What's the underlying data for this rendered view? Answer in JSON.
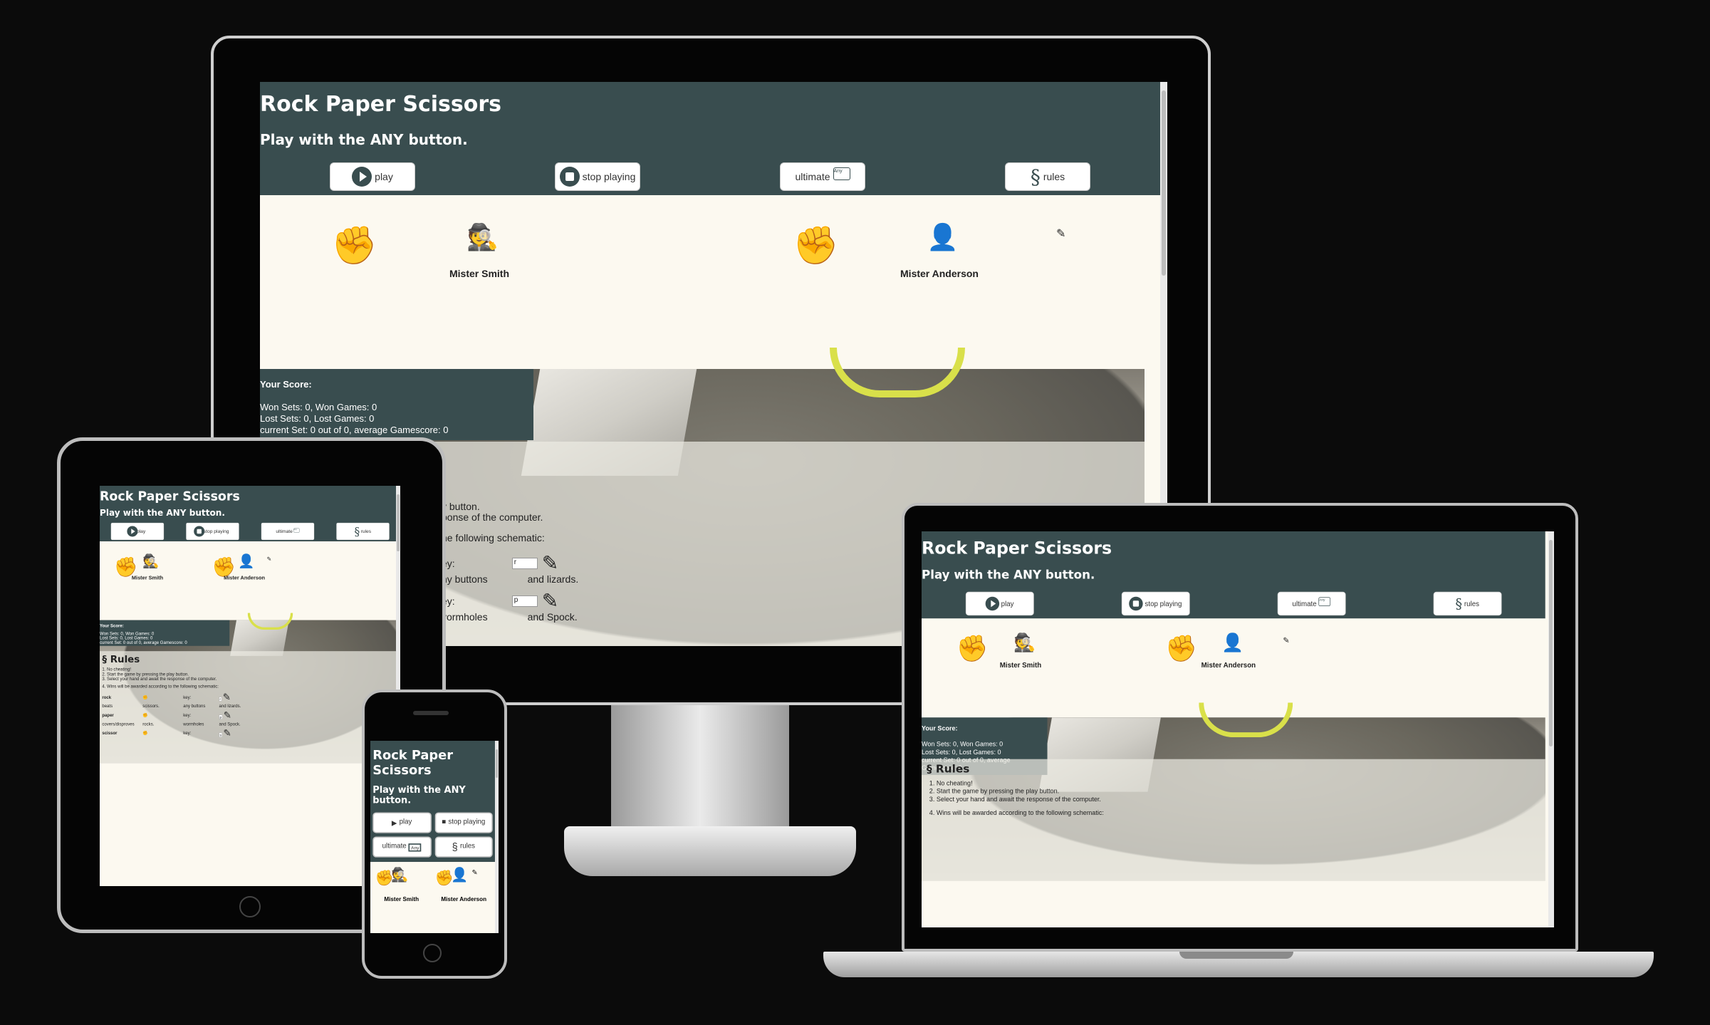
{
  "app": {
    "title": "Rock Paper Scissors",
    "subtitle": "Play with the ANY button.",
    "buttons": {
      "play": "play",
      "stop": "stop playing",
      "ultimate": "ultimate",
      "any_key": "Any",
      "rules": "rules",
      "rules_symbol": "§"
    },
    "players": {
      "left_name": "Mister Smith",
      "right_name": "Mister Anderson",
      "hand_icon": "✊",
      "left_avatar": "spy-icon",
      "right_avatar": "user-tie-icon"
    },
    "score": {
      "title": "Your Score:",
      "line1": "Won Sets: 0, Won Games: 0",
      "line2": "Lost Sets: 0, Lost Games: 0",
      "line3": "current Set: 0 out of 0, average Gamescore: 0"
    },
    "rules": {
      "heading": "Rules",
      "items": [
        "No cheating!",
        "Start the game by pressing the play button.",
        "Select your hand and await the response of the computer.",
        "Wins will be awarded according to the following schematic:"
      ],
      "table": [
        {
          "hand": "rock",
          "verb": "beats",
          "target": "scissors.",
          "key_label": "key:",
          "key_value": "r",
          "extra": "any buttons",
          "extra2": "and lizards."
        },
        {
          "hand": "paper",
          "verb": "covers/disproves",
          "target": "rocks.",
          "key_label": "key:",
          "key_value": "p",
          "extra": "wormholes",
          "extra2": "and Spock."
        },
        {
          "hand": "scissor",
          "verb": "",
          "target": "",
          "key_label": "key:",
          "key_value": "s",
          "extra": "",
          "extra2": ""
        }
      ],
      "desktop_partial": {
        "line_a": "y button.",
        "line_b": "ponse of the computer.",
        "line_c": "he following schematic:",
        "key1": "ey:",
        "any1": "ny buttons",
        "and1": "and lizards.",
        "key2": "ey:",
        "any2": "vormholes",
        "and2": "and Spock."
      }
    }
  }
}
